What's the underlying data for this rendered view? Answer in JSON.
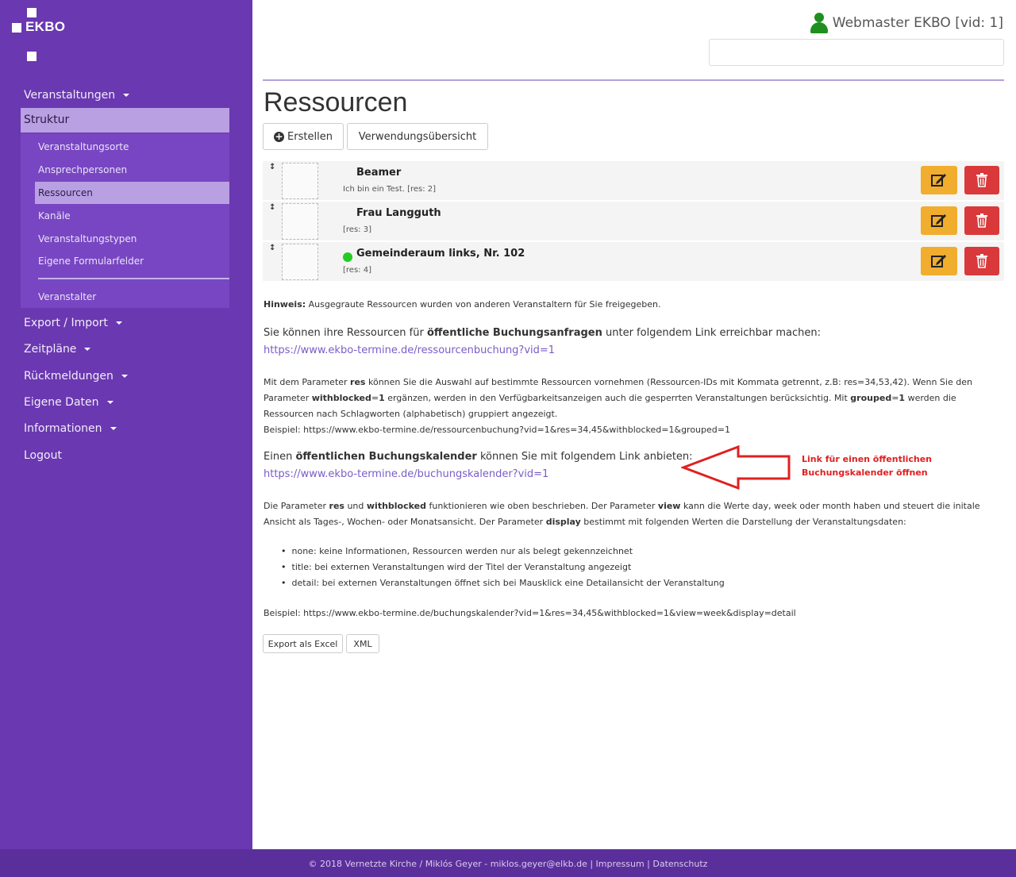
{
  "brand": {
    "name": "EKBO"
  },
  "sidebar": {
    "top_items": [
      {
        "label": "Veranstaltungen"
      },
      {
        "label": "Struktur"
      },
      {
        "label": "Export / Import"
      },
      {
        "label": "Zeitpläne"
      },
      {
        "label": "Rückmeldungen"
      },
      {
        "label": "Eigene Daten"
      },
      {
        "label": "Informationen"
      },
      {
        "label": "Logout"
      }
    ],
    "sub_items": [
      {
        "label": "Veranstaltungsorte"
      },
      {
        "label": "Ansprechpersonen"
      },
      {
        "label": "Ressourcen"
      },
      {
        "label": "Kanäle"
      },
      {
        "label": "Veranstaltungstypen"
      },
      {
        "label": "Eigene Formularfelder"
      },
      {
        "label": "Veranstalter"
      }
    ]
  },
  "header": {
    "user": "Webmaster EKBO [vid: 1]",
    "search_value": ""
  },
  "page": {
    "title": "Ressourcen",
    "create_label": "Erstellen",
    "overview_label": "Verwendungsübersicht"
  },
  "resources": [
    {
      "name": "Beamer",
      "sub": "Ich bin ein Test. [res: 2]",
      "status_color": "#f4f4f4"
    },
    {
      "name": "Frau Langguth",
      "sub": "[res: 3]",
      "status_color": "#f4f4f4"
    },
    {
      "name": "Gemeinderaum links, Nr. 102",
      "sub": "[res: 4]",
      "status_color": "#22cc22"
    }
  ],
  "colors": {
    "sidebar": "#6a38b0",
    "edit": "#f0ad2e",
    "delete": "#d9393b",
    "accent": "#7a5cc8"
  },
  "info": {
    "hint_label": "Hinweis:",
    "hint_text": " Ausgegraute Ressourcen wurden von anderen Veranstaltern für Sie freigegeben.",
    "booking_pre": "Sie können ihre Ressourcen für ",
    "booking_bold": "öffentliche Buchungsanfragen",
    "booking_post": " unter folgendem Link erreichbar machen:",
    "booking_link": "https://www.ekbo-termine.de/ressourcenbuchung?vid=1",
    "p1_a": "Mit dem Parameter ",
    "p1_res": "res",
    "p1_b": " können Sie die Auswahl auf bestimmte Ressourcen vornehmen (Ressourcen-IDs mit Kommata getrennt, z.B: res=34,53,42). Wenn Sie den Parameter ",
    "p1_wb": "withblocked",
    "p1_c": "=",
    "p1_one": "1",
    "p1_d": " ergänzen, werden in den Verfügbarkeitsanzeigen auch die gesperrten Veranstaltungen berücksichtig. Mit ",
    "p1_grouped": "grouped",
    "p1_e": "=",
    "p1_one2": "1",
    "p1_f": " werden die Ressourcen nach Schlagworten (alphabetisch) gruppiert angezeigt.",
    "example1": "Beispiel: https://www.ekbo-termine.de/ressourcenbuchung?vid=1&res=34,45&withblocked=1&grouped=1",
    "cal_pre": "Einen ",
    "cal_bold": "öffentlichen Buchungskalender",
    "cal_post": " können Sie mit folgendem Link anbieten:",
    "cal_link": "https://www.ekbo-termine.de/buchungskalender?vid=1",
    "note_line1": "Link für einen öffentlichen",
    "note_line2": "Buchungskalender öffnen",
    "p2_a": "Die Parameter ",
    "p2_res": "res",
    "p2_b": " und ",
    "p2_wb": "withblocked",
    "p2_c": " funktionieren wie oben beschrieben. Der Parameter ",
    "p2_view": "view",
    "p2_d": " kann die Werte day, week oder month haben und steuert die initale Ansicht als Tages-, Wochen- oder Monatsansicht. Der Parameter ",
    "p2_display": "display",
    "p2_e": " bestimmt mit folgenden Werten die Darstellung der Veranstaltungsdaten:",
    "bullets": [
      "none: keine Informationen, Ressourcen werden nur als belegt gekennzeichnet",
      "title: bei externen Veranstaltungen wird der Titel der Veranstaltung angezeigt",
      "detail: bei externen Veranstaltungen öffnet sich bei Mausklick eine Detailansicht der Veranstaltung"
    ],
    "example2": "Beispiel: https://www.ekbo-termine.de/buchungskalender?vid=1&res=34,45&withblocked=1&view=week&display=detail",
    "export_excel": "Export als Excel",
    "export_xml": "XML"
  },
  "footer": "© 2018 Vernetzte Kirche / Miklós Geyer - miklos.geyer@elkb.de | Impressum | Datenschutz"
}
